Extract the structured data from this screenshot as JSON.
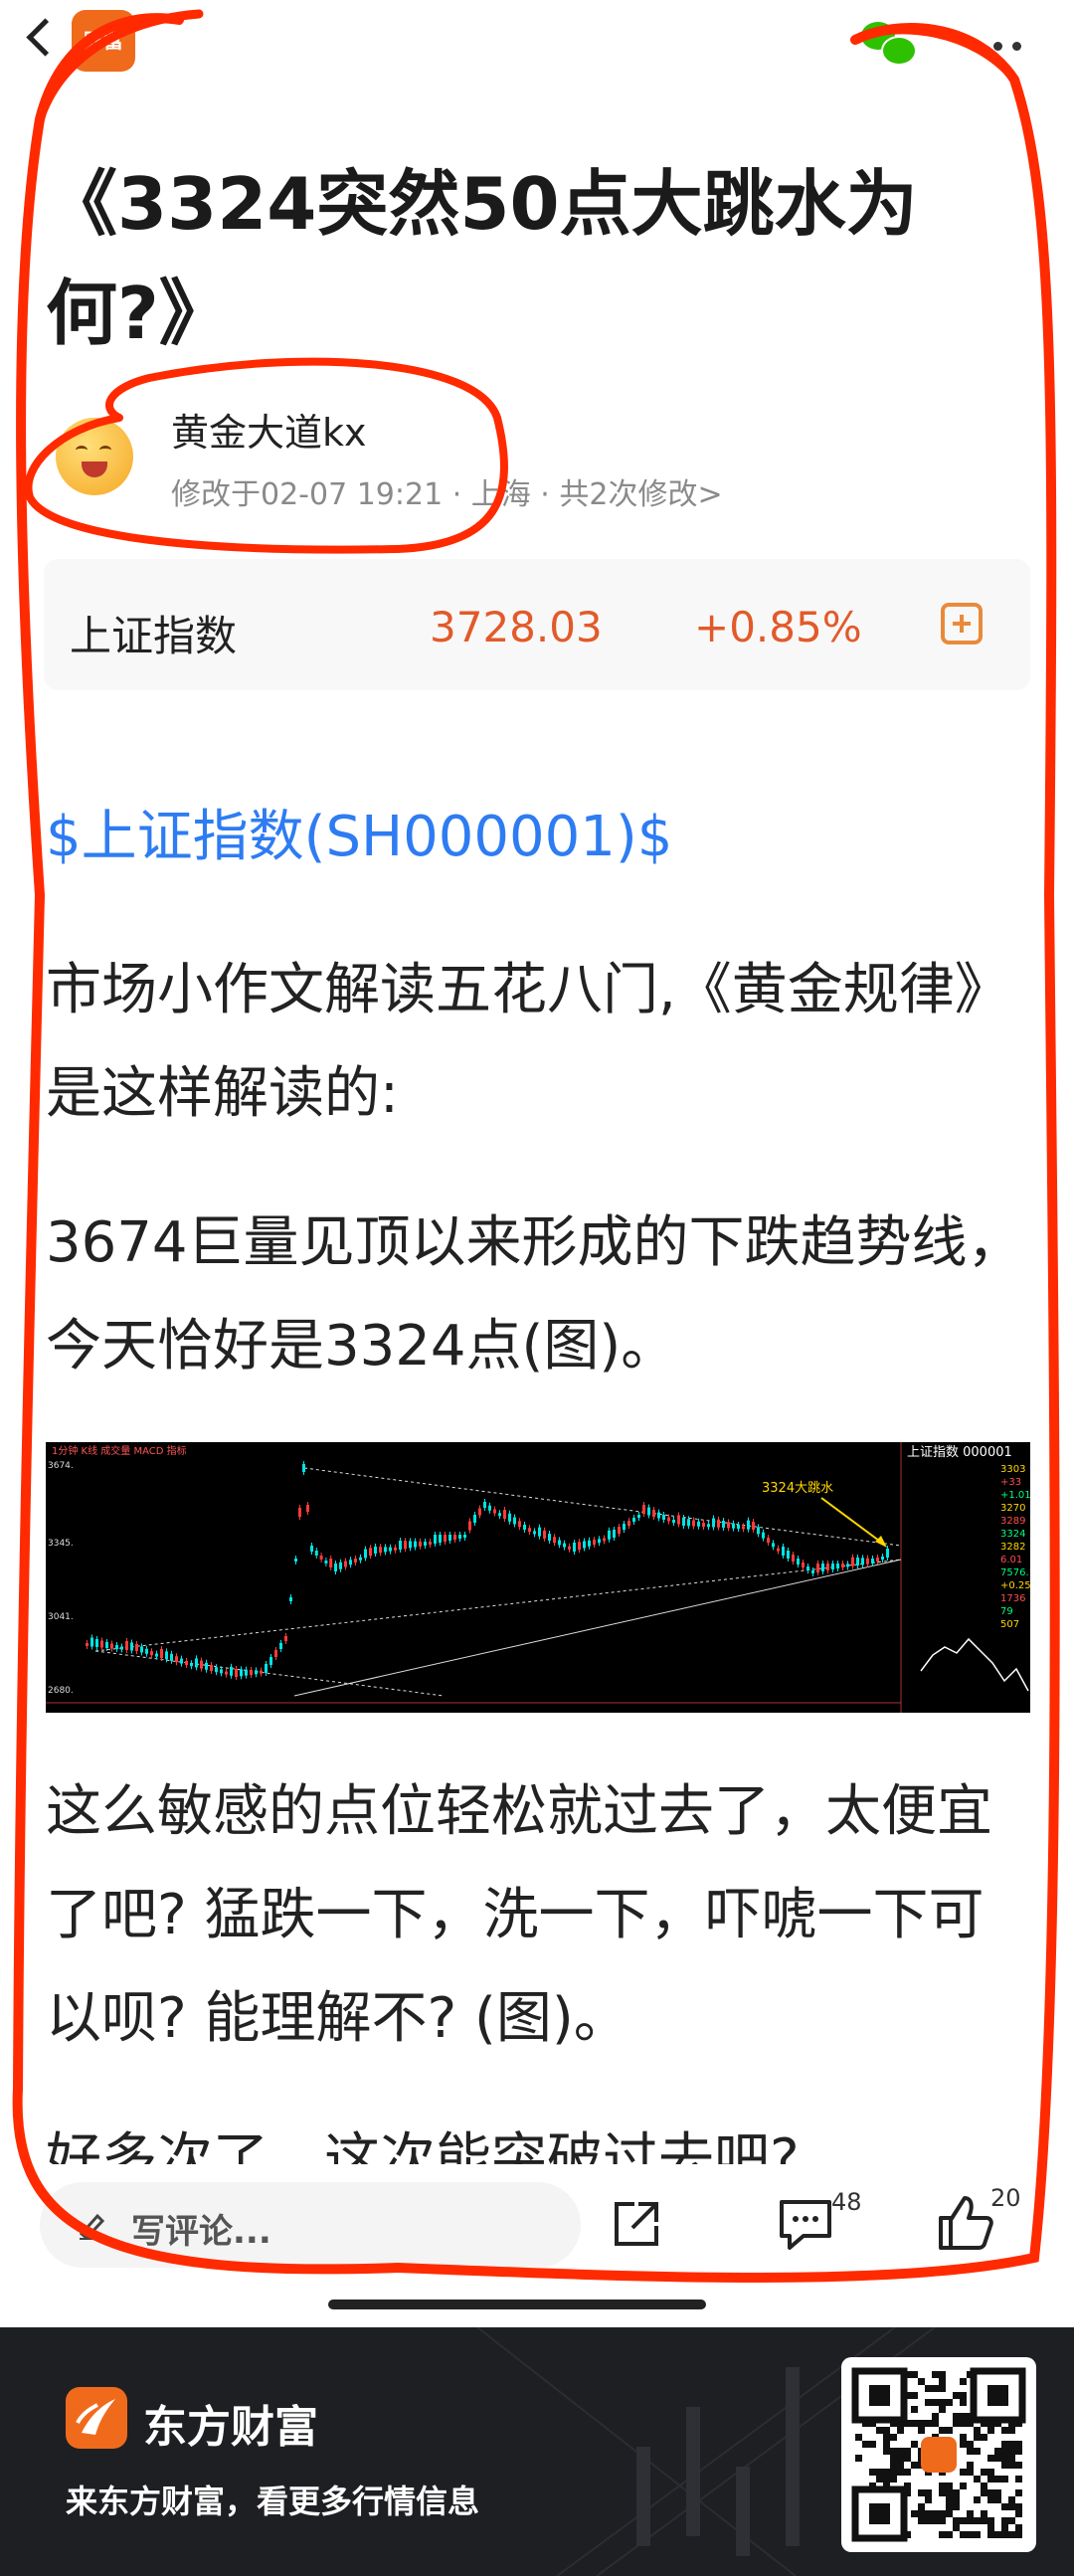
{
  "topbar": {
    "app_logo_text": "财富"
  },
  "article": {
    "title": "《3324突然50点大跳水为何?》",
    "author": {
      "name": "黄金大道kx",
      "meta": "修改于02-07 19:21 · 上海 · 共2次修改>"
    },
    "quote": {
      "name": "上证指数",
      "price": "3728.03",
      "change": "+0.85%"
    },
    "stock_link": "$上证指数(SH000001)$",
    "para1": "市场小作文解读五花八门,《黄金规律》是这样解读的:",
    "para2": "3674巨量见顶以来形成的下跌趋势线，今天恰好是3324点(图)。",
    "para3": "这么敏感的点位轻松就过去了，太便宜了吧? 猛跌一下，洗一下，吓唬一下可以呗? 能理解不? (图)。",
    "para4_cut": "好多次了，这次能突破过去吧?"
  },
  "chart": {
    "header": "1分钟 K线 成交量 MACD 指标",
    "annotation": "3324大跳水",
    "side_title": "上证指数 000001",
    "ylabels": [
      "3674.",
      "3345.",
      "3041.",
      "2680."
    ],
    "side_values": [
      "3303",
      "+33",
      "+1.01",
      "3270",
      "3289",
      "3324",
      "3282",
      "6.01",
      "7576.14",
      "+0.25",
      "1736",
      "79",
      "507"
    ],
    "colors": {
      "up": "#ff3b3b",
      "down": "#00e5e5",
      "line": "#ffffff",
      "annotation": "#ffd700"
    }
  },
  "bottombar": {
    "comment_placeholder": "写评论...",
    "comment_count": "48",
    "like_count": "20"
  },
  "footer": {
    "brand": "东方财富",
    "slogan": "来东方财富，看更多行情信息"
  },
  "colors": {
    "accent": "#e25a2a",
    "link": "#2e7cf2",
    "brand": "#f06a1c",
    "marker": "#ff2a00"
  }
}
